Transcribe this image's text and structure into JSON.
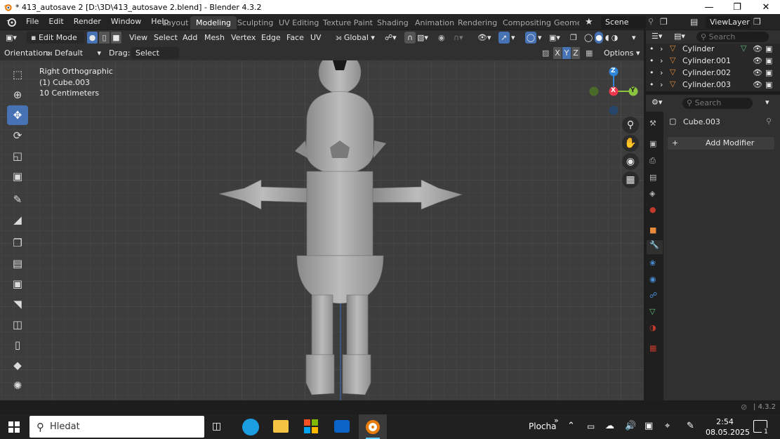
{
  "window": {
    "title": "* 413_autosave 2 [D:\\3D\\413_autosave 2.blend] - Blender 4.3.2",
    "minimize_icon": "minimize-icon",
    "maximize_icon": "restore-icon",
    "close_icon": "close-icon"
  },
  "menu": [
    "File",
    "Edit",
    "Render",
    "Window",
    "Help"
  ],
  "workspaces": {
    "tabs": [
      "Layout",
      "Modeling",
      "Sculpting",
      "UV Editing",
      "Texture Paint",
      "Shading",
      "Animation",
      "Rendering",
      "Compositing",
      "Geome"
    ],
    "active": "Modeling"
  },
  "scene": {
    "label": "Scene"
  },
  "view_layer": {
    "label": "ViewLayer"
  },
  "header": {
    "mode": "Edit Mode",
    "menus": [
      "View",
      "Select",
      "Add",
      "Mesh",
      "Vertex",
      "Edge",
      "Face",
      "UV"
    ],
    "transform_orientation": "Global"
  },
  "tool_settings": {
    "orientation_label": "Orientation:",
    "orientation_value": "Default",
    "drag_label": "Drag:",
    "drag_value": "Select Box",
    "axes": [
      "X",
      "Y",
      "Z"
    ],
    "options_label": "Options"
  },
  "viewport": {
    "view_name": "Right Orthographic",
    "object_name": "(1) Cube.003",
    "scale": "10 Centimeters",
    "gizmo_axes": [
      "Z",
      "X",
      "Y"
    ]
  },
  "tools": [
    "select-box",
    "cursor",
    "move",
    "rotate",
    "scale",
    "transform",
    "annotate",
    "measure",
    "add-cube",
    "extrude",
    "inset",
    "bevel",
    "loop-cut",
    "knife",
    "shrink",
    "spin"
  ],
  "outliner": {
    "search_placeholder": "Search",
    "items": [
      {
        "label": "Cylinder"
      },
      {
        "label": "Cylinder.001"
      },
      {
        "label": "Cylinder.002"
      },
      {
        "label": "Cylinder.003"
      }
    ]
  },
  "properties": {
    "search_placeholder": "Search",
    "object_name": "Cube.003",
    "add_modifier": "Add Modifier"
  },
  "status": {
    "version": "4.3.2"
  },
  "taskbar": {
    "search_placeholder": "Hledat",
    "desktop_label": "Plocha",
    "time": "2:54",
    "date": "08.05.2025",
    "notification_count": "1"
  },
  "colors": {
    "accent": "#4772b3",
    "axis_x": "#f0364c",
    "axis_y": "#8bc53f",
    "axis_z": "#2f86d8",
    "object_orange": "#e88a3a"
  }
}
